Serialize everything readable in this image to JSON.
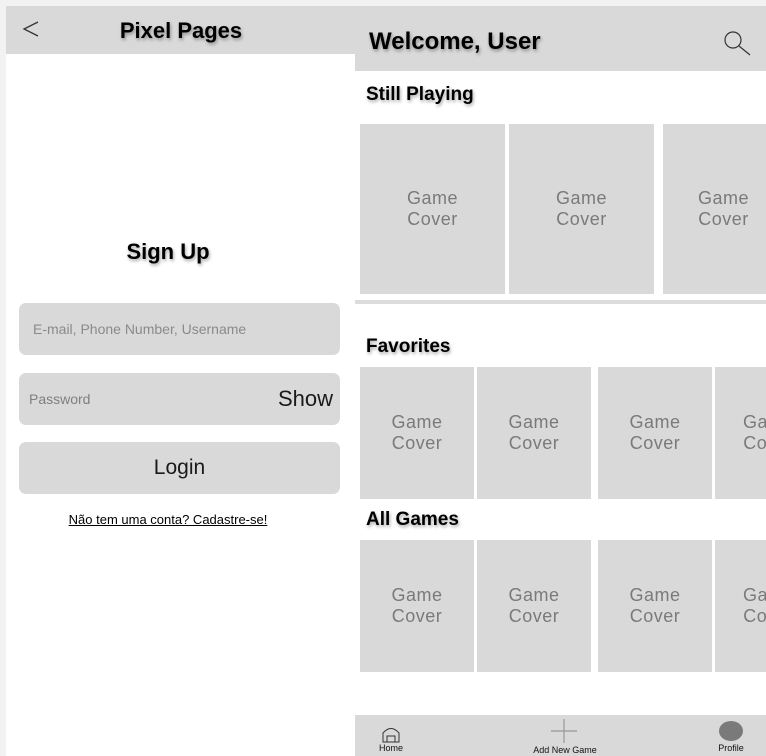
{
  "signup_screen": {
    "header": {
      "title": "Pixel Pages",
      "back_icon": "chevron-left-icon"
    },
    "heading": "Sign Up",
    "email_field": {
      "placeholder": "E-mail, Phone Number, Username",
      "value": ""
    },
    "password_field": {
      "placeholder": "Password",
      "value": "",
      "show_label": "Show"
    },
    "login_button": "Login",
    "signup_link": "Não tem uma conta? Cadastre-se!"
  },
  "home_screen": {
    "header": {
      "title": "Welcome, User",
      "search_icon": "search-icon"
    },
    "sections": {
      "still_playing": {
        "title": "Still Playing",
        "items": [
          {
            "line1": "Game",
            "line2": "Cover"
          },
          {
            "line1": "Game",
            "line2": "Cover"
          },
          {
            "line1": "Game",
            "line2": "Cover"
          }
        ]
      },
      "favorites": {
        "title": "Favorites",
        "items": [
          {
            "line1": "Game",
            "line2": "Cover"
          },
          {
            "line1": "Game",
            "line2": "Cover"
          },
          {
            "line1": "Game",
            "line2": "Cover"
          },
          {
            "line1": "Game",
            "line2": "Cover"
          }
        ]
      },
      "all_games": {
        "title": "All Games",
        "items": [
          {
            "line1": "Game",
            "line2": "Cover"
          },
          {
            "line1": "Game",
            "line2": "Cover"
          },
          {
            "line1": "Game",
            "line2": "Cover"
          },
          {
            "line1": "Game",
            "line2": "Cover"
          }
        ]
      }
    },
    "bottom_nav": {
      "home": {
        "label": "Home",
        "icon": "home-icon"
      },
      "add": {
        "label": "Add New Game",
        "icon": "plus-icon"
      },
      "profile": {
        "label": "Profile",
        "icon": "avatar-icon"
      }
    }
  },
  "colors": {
    "panel": "#d9d9d9",
    "background": "#ffffff",
    "placeholder_text": "#8a8a8a",
    "cover_text": "#7a7a7a"
  }
}
